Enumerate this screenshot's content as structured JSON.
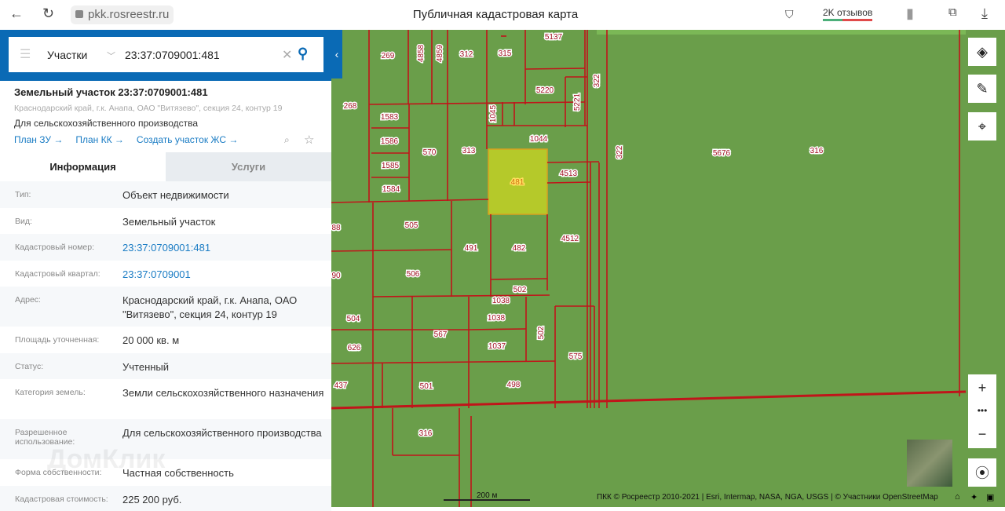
{
  "browser": {
    "url": "pkk.rosreestr.ru",
    "title": "Публичная кадастровая карта",
    "reviews": "2K отзывов"
  },
  "search": {
    "category": "Участки",
    "query": "23:37:0709001:481"
  },
  "object": {
    "title": "Земельный участок 23:37:0709001:481",
    "address": "Краснодарский край, г.к. Анапа, ОАО \"Витязево\", секция 24, контур 19",
    "purpose": "Для сельскохозяйственного производства",
    "links": [
      "План ЗУ →",
      "План КК →",
      "Создать участок ЖС →"
    ]
  },
  "tabs": [
    "Информация",
    "Услуги"
  ],
  "rows": [
    {
      "label": "Тип:",
      "value": "Объект недвижимости"
    },
    {
      "label": "Вид:",
      "value": "Земельный участок"
    },
    {
      "label": "Кадастровый номер:",
      "value": "23:37:0709001:481",
      "link": true
    },
    {
      "label": "Кадастровый квартал:",
      "value": "23:37:0709001",
      "link": true
    },
    {
      "label": "Адрес:",
      "value": "Краснодарский край, г.к. Анапа, ОАО \"Витязево\", секция 24, контур 19"
    },
    {
      "label": "Площадь уточненная:",
      "value": "20 000 кв. м"
    },
    {
      "label": "Статус:",
      "value": "Учтенный"
    },
    {
      "label": "Категория земель:",
      "value": "Земли сельскохозяйственного назначения"
    },
    {
      "label": "Разрешенное использование:",
      "value": "Для сельскохозяйственного производства"
    },
    {
      "label": "Форма собственности:",
      "value": "Частная собственность"
    },
    {
      "label": "Кадастровая стоимость:",
      "value": "225 200 руб."
    }
  ],
  "watermark": "ДомКлик",
  "map": {
    "parcels": [
      "5137",
      "269",
      "4858",
      "4859",
      "312",
      "315",
      "322",
      "5220",
      "5221",
      "268",
      "1583",
      "1045",
      "1586",
      "1044",
      "570",
      "313",
      "322",
      "5676",
      "316",
      "4513",
      "1585",
      "481",
      "1584",
      "88",
      "505",
      "4512",
      "491",
      "482",
      "90",
      "506",
      "502",
      "1038",
      "504",
      "1038",
      "567",
      "502",
      "1037",
      "626",
      "575",
      "437",
      "501",
      "498",
      "316"
    ],
    "scale": "200 м",
    "attribution": "ПКК © Росреестр 2010-2021 | Esri, Intermap, NASA, NGA, USGS | © Участники OpenStreetMap",
    "colors": {
      "ground": "#6a9e4a",
      "border": "#c0151a",
      "selected": "#b5c92a"
    }
  }
}
